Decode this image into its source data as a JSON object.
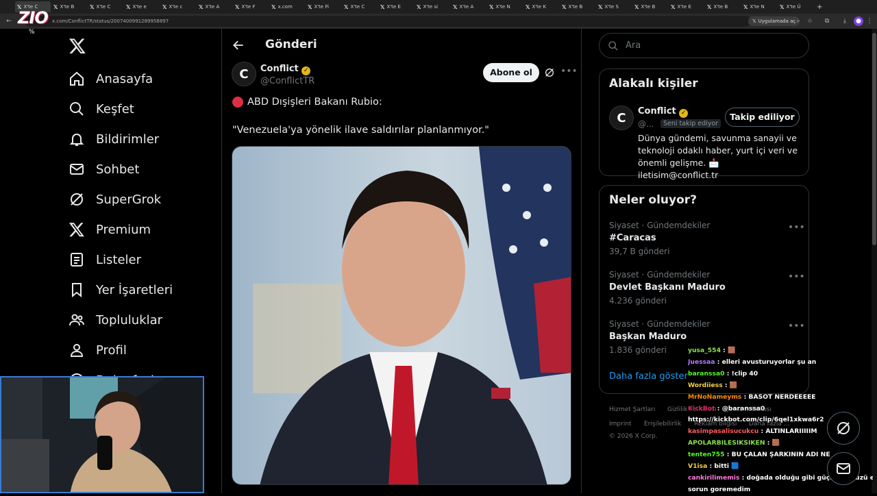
{
  "browser": {
    "active_tab": "X'te C",
    "tabs": [
      "X'te B",
      "X'te C",
      "X'te e",
      "X'te c",
      "X'te A",
      "X'te F",
      "x.com",
      "X'te Fi",
      "X'te C",
      "X'te E",
      "X'te si",
      "X'te A",
      "X'te N",
      "X'te K",
      "X'te B",
      "X'te S",
      "X'te B",
      "X'te E",
      "X'te B",
      "X'te N",
      "X'te Ü"
    ],
    "url": "x.com/ConflictTR/status/2007400991289958897",
    "open_in_app": "Uygulamada aç",
    "new_tab": "+"
  },
  "logo": {
    "text": "ZIO",
    "badge": "%"
  },
  "nav": {
    "items": [
      {
        "label": "Anasayfa",
        "icon": "home-icon"
      },
      {
        "label": "Keşfet",
        "icon": "search-icon"
      },
      {
        "label": "Bildirimler",
        "icon": "bell-icon"
      },
      {
        "label": "Sohbet",
        "icon": "mail-icon"
      },
      {
        "label": "SuperGrok",
        "icon": "grok-icon"
      },
      {
        "label": "Premium",
        "icon": "x-icon"
      },
      {
        "label": "Listeler",
        "icon": "list-icon"
      },
      {
        "label": "Yer İşaretleri",
        "icon": "bookmark-icon"
      },
      {
        "label": "Topluluklar",
        "icon": "people-icon"
      },
      {
        "label": "Profil",
        "icon": "person-icon"
      },
      {
        "label": "Daha fazla",
        "icon": "more-circle-icon"
      }
    ]
  },
  "post": {
    "header_title": "Gönderi",
    "author_name": "Conflict",
    "author_handle": "@ConflictTR",
    "subscribe_label": "Abone ol",
    "line1": "ABD Dışişleri Bakanı Rubio:",
    "line2": "\"Venezuela'ya yönelik ilave saldırılar planlanmıyor.\""
  },
  "search": {
    "placeholder": "Ara"
  },
  "related": {
    "title": "Alakalı kişiler",
    "name": "Conflict",
    "handle": "@...",
    "follows_you": "Seni takip ediyor",
    "follow_label": "Takip ediliyor",
    "bio": "Dünya gündemi, savunma sanayii ve teknoloji odaklı haber, yurt içi veri ve önemli gelişme. 📩 iletisim@conflict.tr"
  },
  "trends": {
    "title": "Neler oluyor?",
    "items": [
      {
        "category": "Siyaset · Gündemdekiler",
        "name": "#Caracas",
        "count": "39,7 B gönderi"
      },
      {
        "category": "Siyaset · Gündemdekiler",
        "name": "Devlet Başkanı Maduro",
        "count": "4.236 gönderi"
      },
      {
        "category": "Siyaset · Gündemdekiler",
        "name": "Başkan Maduro",
        "count": "1.836 gönderi"
      }
    ],
    "show_more": "Daha fazla göster"
  },
  "footer": {
    "links": [
      "Hizmet Şartları",
      "Gizlilik Politikası",
      "Çerez Politikası",
      "Imprint",
      "Erişilebilirlik",
      "Reklam bilgisi",
      "Daha fazla ..."
    ],
    "copyright": "© 2026 X Corp."
  },
  "chat": [
    {
      "user": "yusa_554",
      "msg": "🟫",
      "color": "#8be04e"
    },
    {
      "user": "Juessaa",
      "msg": "elleri avusturuyorlar şu an",
      "color": "#b37bff"
    },
    {
      "user": "baranssa0",
      "msg": "!clip 40",
      "color": "#53fc18"
    },
    {
      "user": "Wordiiess",
      "msg": "🟫",
      "color": "#f5d042"
    },
    {
      "user": "MrNoNameyms",
      "msg": "BASOT NERDEEEEE",
      "color": "#ff8c00"
    },
    {
      "user": "KickBot",
      "msg": "@baranssa0",
      "color": "#e0245e"
    },
    {
      "user": "",
      "msg": "https://kickbot.com/clip/6qel1xkwa6r2",
      "color": "#ffffff"
    },
    {
      "user": "kasimpasalisucukcu",
      "msg": "ALTINLARIIIIIM",
      "color": "#ff5c5c"
    },
    {
      "user": "APOLARBILESIKSIKEN",
      "msg": "🟫",
      "color": "#8be04e"
    },
    {
      "user": "tenten755",
      "msg": "BU ÇALAN ŞARKININ ADI NE",
      "color": "#53fc18"
    },
    {
      "user": "V1isa",
      "msg": "bitti 🟦",
      "color": "#f5d042"
    },
    {
      "user": "cankirilimemis",
      "msg": "doğada olduğu gibi güçlü güçsüzü eziyo bi",
      "color": "#ff7ad9"
    },
    {
      "user": "",
      "msg": "sorun goremedim",
      "color": "#ffffff"
    }
  ],
  "colors": {
    "accent": "#1d9bf0",
    "verified": "#e2b719",
    "bg": "#000000",
    "border": "#2f3336"
  }
}
